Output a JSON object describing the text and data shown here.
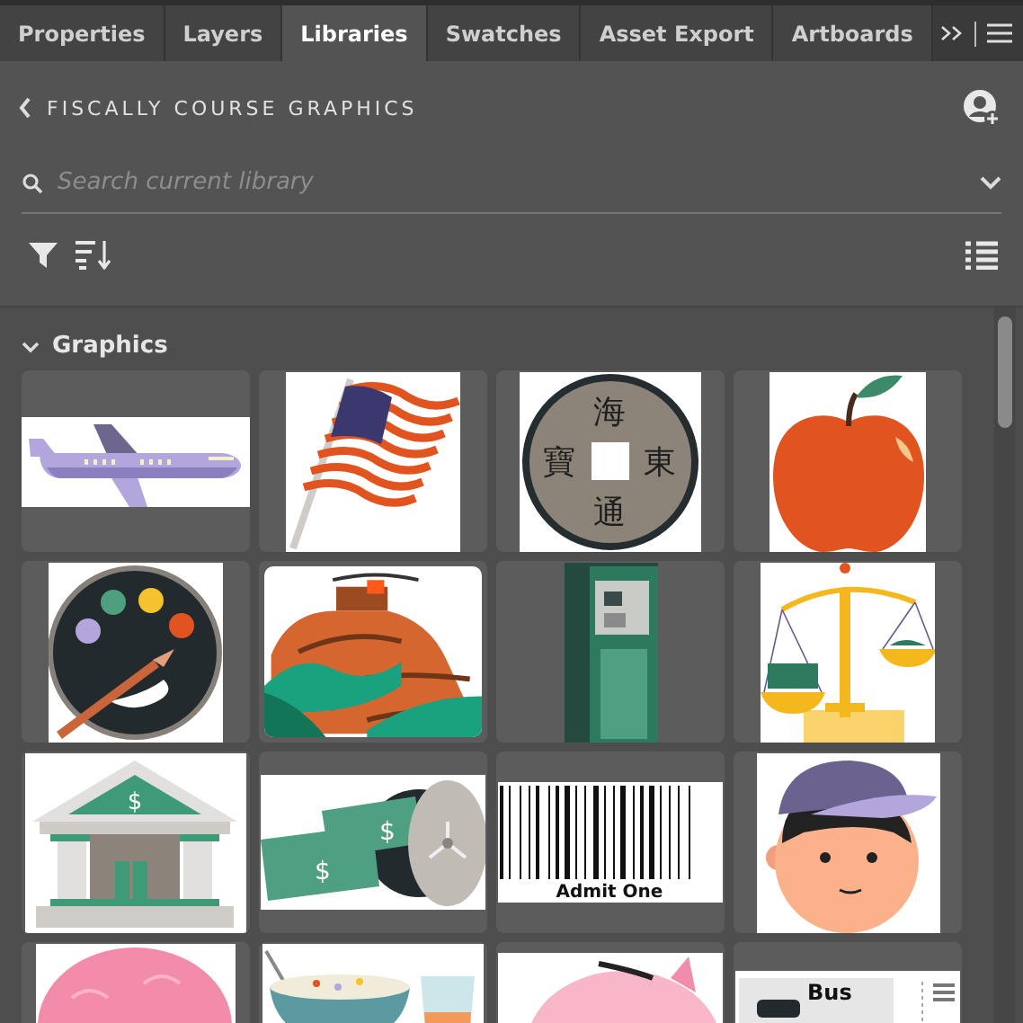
{
  "tabs": [
    {
      "label": "Properties",
      "selected": false
    },
    {
      "label": "Layers",
      "selected": false
    },
    {
      "label": "Libraries",
      "selected": true
    },
    {
      "label": "Swatches",
      "selected": false
    },
    {
      "label": "Asset Export",
      "selected": false
    },
    {
      "label": "Artboards",
      "selected": false
    }
  ],
  "library": {
    "title": "FISCALLY COURSE GRAPHICS"
  },
  "search": {
    "placeholder": "Search current library"
  },
  "section": {
    "title": "Graphics",
    "expanded": true
  },
  "graphics": [
    {
      "kind": "airplane"
    },
    {
      "kind": "flag"
    },
    {
      "kind": "coin",
      "characters": [
        "海",
        "東",
        "通",
        "寶"
      ]
    },
    {
      "kind": "apple"
    },
    {
      "kind": "palette"
    },
    {
      "kind": "mountain"
    },
    {
      "kind": "atm"
    },
    {
      "kind": "scale"
    },
    {
      "kind": "bank",
      "symbols": [
        "$"
      ]
    },
    {
      "kind": "money",
      "symbols": [
        "$",
        "$"
      ]
    },
    {
      "kind": "barcode",
      "caption": "Admit One"
    },
    {
      "kind": "face"
    },
    {
      "kind": "brain"
    },
    {
      "kind": "cereal"
    },
    {
      "kind": "piggy"
    },
    {
      "kind": "sign",
      "caption": "Bus"
    }
  ]
}
